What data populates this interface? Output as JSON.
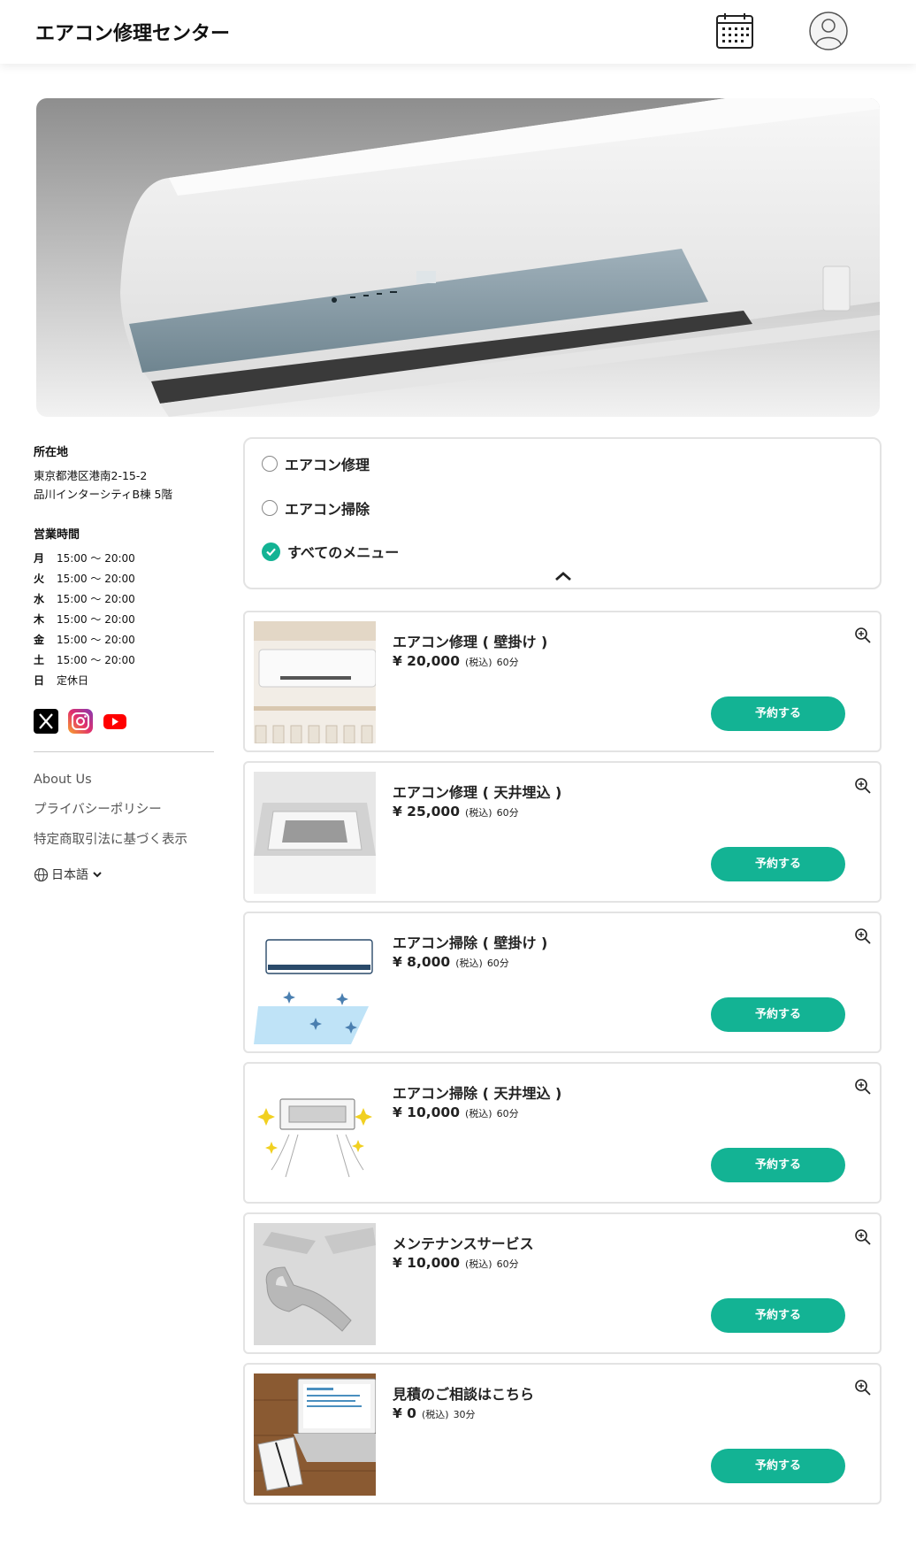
{
  "header": {
    "title": "エアコン修理センター"
  },
  "sidebar": {
    "address_heading": "所在地",
    "address_line1": "東京都港区港南2-15-2",
    "address_line2": "品川インターシティB棟 5階",
    "hours_heading": "営業時間",
    "hours": [
      {
        "day": "月",
        "time": "15:00 ～ 20:00"
      },
      {
        "day": "火",
        "time": "15:00 ～ 20:00"
      },
      {
        "day": "水",
        "time": "15:00 ～ 20:00"
      },
      {
        "day": "木",
        "time": "15:00 ～ 20:00"
      },
      {
        "day": "金",
        "time": "15:00 ～ 20:00"
      },
      {
        "day": "土",
        "time": "15:00 ～ 20:00"
      },
      {
        "day": "日",
        "time": "定休日"
      }
    ],
    "social_icons": [
      "x-icon",
      "instagram-icon",
      "youtube-icon"
    ],
    "links": [
      "About Us",
      "プライバシーポリシー",
      "特定商取引法に基づく表示"
    ],
    "language": "日本語"
  },
  "filter": {
    "options": [
      {
        "label": "エアコン修理",
        "selected": false
      },
      {
        "label": "エアコン掃除",
        "selected": false
      },
      {
        "label": "すべてのメニュー",
        "selected": true
      }
    ]
  },
  "services": [
    {
      "name": "エアコン修理 ( 壁掛け )",
      "price": "¥ 20,000",
      "tax": "(税込)",
      "duration": "60分",
      "button": "予約する"
    },
    {
      "name": "エアコン修理 ( 天井埋込 )",
      "price": "¥ 25,000",
      "tax": "(税込)",
      "duration": "60分",
      "button": "予約する"
    },
    {
      "name": "エアコン掃除 ( 壁掛け )",
      "price": "¥ 8,000",
      "tax": "(税込)",
      "duration": "60分",
      "button": "予約する"
    },
    {
      "name": "エアコン掃除 ( 天井埋込 )",
      "price": "¥ 10,000",
      "tax": "(税込)",
      "duration": "60分",
      "button": "予約する"
    },
    {
      "name": "メンテナンスサービス",
      "price": "¥ 10,000",
      "tax": "(税込)",
      "duration": "60分",
      "button": "予約する"
    },
    {
      "name": "見積のご相談はこちら",
      "price": "¥ 0",
      "tax": "(税込)",
      "duration": "30分",
      "button": "予約する"
    }
  ],
  "colors": {
    "accent": "#13b394",
    "border": "#e3e3e3"
  }
}
